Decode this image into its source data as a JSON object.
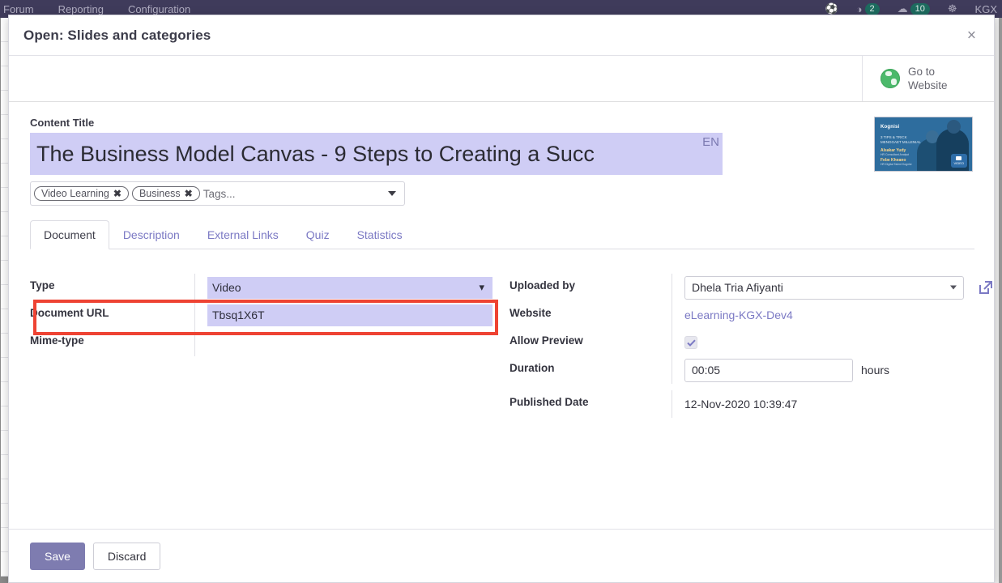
{
  "topbar": {
    "nav_items": [
      "Forum",
      "Reporting",
      "Configuration"
    ],
    "icons": [
      {
        "name": "bug-icon",
        "glyph": "☔"
      },
      {
        "name": "clock-icon",
        "glyph": "◔",
        "badge": "2"
      },
      {
        "name": "chat-icon",
        "glyph": "☁",
        "badge": "10"
      },
      {
        "name": "contacts-icon",
        "glyph": "☸"
      }
    ],
    "user_name": "KGX"
  },
  "modal": {
    "title": "Open: Slides and categories",
    "close_label": "×"
  },
  "control_bar": {
    "go_to_website_label": "Go to\nWebsite",
    "go_to_website_line1": "Go to",
    "go_to_website_line2": "Website"
  },
  "content": {
    "title_label": "Content Title",
    "title_value": "The Business Model Canvas - 9 Steps to Creating a Succ",
    "lang_badge": "EN",
    "tags": [
      {
        "label": "Video Learning",
        "remove": "✖"
      },
      {
        "label": "Business",
        "remove": "✖"
      }
    ],
    "tags_placeholder": "Tags..."
  },
  "tabs": [
    {
      "label": "Document",
      "active": true
    },
    {
      "label": "Description",
      "active": false
    },
    {
      "label": "External Links",
      "active": false
    },
    {
      "label": "Quiz",
      "active": false
    },
    {
      "label": "Statistics",
      "active": false
    }
  ],
  "form_left": {
    "type_label": "Type",
    "type_value": "Video",
    "type_options": [
      "Video"
    ],
    "document_url_label": "Document URL",
    "document_url_value": "Tbsq1X6T",
    "mime_type_label": "Mime-type",
    "mime_type_value": ""
  },
  "form_right": {
    "uploaded_by_label": "Uploaded by",
    "uploaded_by_value": "Dhela Tria Afiyanti",
    "website_label": "Website",
    "website_value": "eLearning-KGX-Dev4",
    "allow_preview_label": "Allow Preview",
    "allow_preview_checked": true,
    "duration_label": "Duration",
    "duration_value": "00:05",
    "duration_unit": "hours",
    "published_date_label": "Published Date",
    "published_date_value": "12-Nov-2020 10:39:47"
  },
  "thumbnail": {
    "brand": "Kognisi",
    "headline": "3 TIPS & TRICK MENGGAET MILLENIAL",
    "speaker1_name": "Alsakar Yudy",
    "speaker1_role": "HR Consultant Analyst",
    "speaker2_name": "Febe Kheano",
    "speaker2_role": "HR Digital Talent Kognisi",
    "badge": "VIDEO"
  },
  "footer": {
    "save_label": "Save",
    "discard_label": "Discard"
  },
  "colors": {
    "accent": "#7e7cb0",
    "field_highlight": "#cfcdf5",
    "annotation": "#ee4333",
    "link": "#7b79c4",
    "topbar": "#3f3b5b"
  }
}
